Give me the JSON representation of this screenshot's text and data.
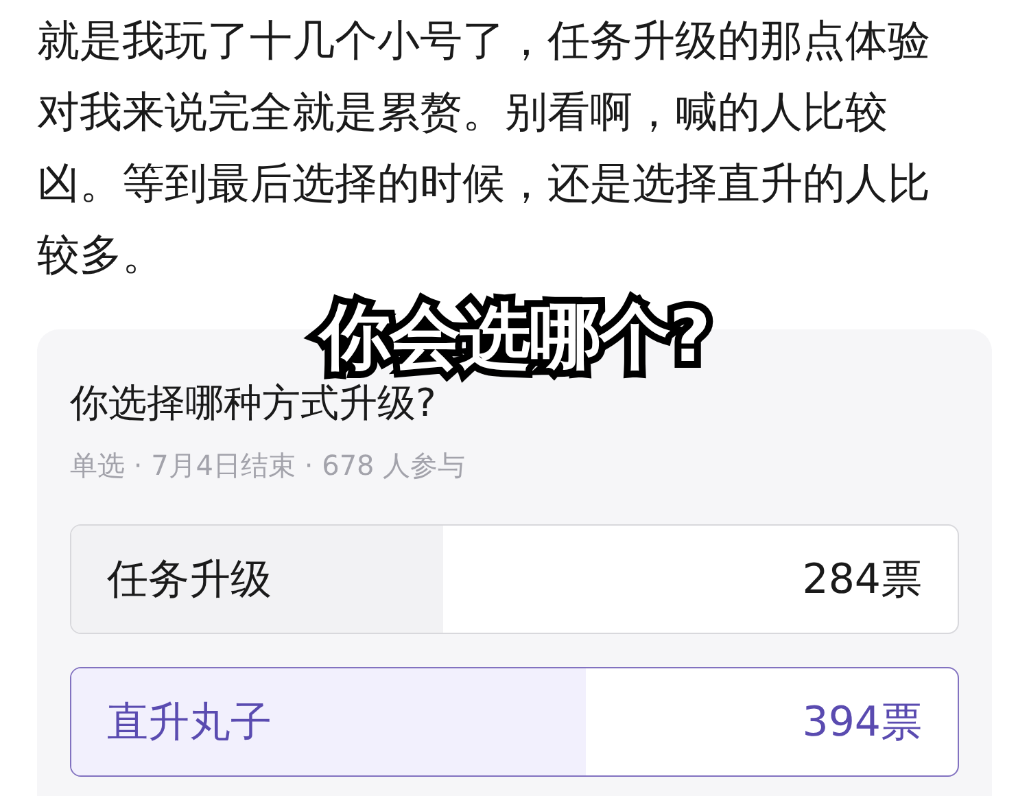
{
  "post": {
    "paragraph": "就是我玩了十几个小号了，任务升级的那点体验对我来说完全就是累赘。别看啊，喊的人比较凶。等到最后选择的时候，还是选择直升的人比较多。"
  },
  "overlay_caption": "你会选哪个?",
  "poll": {
    "title": "你选择哪种方式升级?",
    "meta": "单选 · 7月4日结束 · 678 人参与",
    "options": [
      {
        "label": "任务升级",
        "votes": "284票",
        "level": 0.42,
        "selected": false
      },
      {
        "label": "直升丸子",
        "votes": "394票",
        "level": 0.58,
        "selected": true
      }
    ]
  }
}
